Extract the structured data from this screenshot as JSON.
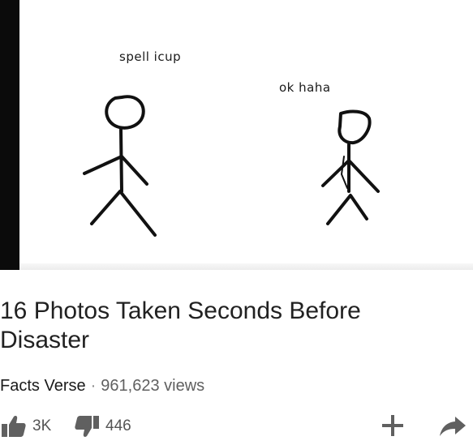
{
  "thumbnail": {
    "caption_left": "spell icup",
    "caption_right": "ok haha"
  },
  "video": {
    "title": "16 Photos Taken Seconds Before Disaster",
    "channel": "Facts Verse",
    "separator": "·",
    "views": "961,623 views"
  },
  "actions": {
    "likes": "3K",
    "dislikes": "446",
    "like_icon": "thumbs-up-icon",
    "dislike_icon": "thumbs-down-icon",
    "add_icon": "plus-icon",
    "share_icon": "share-arrow-icon"
  }
}
